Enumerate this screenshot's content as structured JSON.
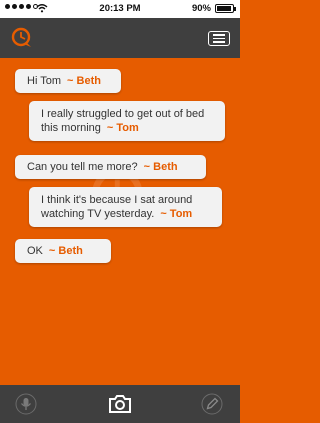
{
  "status_bar": {
    "time": "20:13 PM",
    "battery": "90%"
  },
  "messages": [
    {
      "text": "Hi Tom",
      "author": "~ Beth"
    },
    {
      "text": "I really struggled to get out of bed this morning",
      "author": "~ Tom"
    },
    {
      "text": "Can you tell me more?",
      "author": "~ Beth"
    },
    {
      "text": "I think it's because I sat around watching TV yesterday.",
      "author": "~ Tom"
    },
    {
      "text": "OK",
      "author": "~ Beth"
    }
  ],
  "colors": {
    "accent": "#e65c00",
    "bar": "#3f3f3f",
    "bubble": "#f2f2f2"
  },
  "icons": {
    "logo": "chat-logo-icon",
    "menu": "menu-icon",
    "mic": "microphone-icon",
    "camera": "camera-icon",
    "pencil": "pencil-icon"
  }
}
